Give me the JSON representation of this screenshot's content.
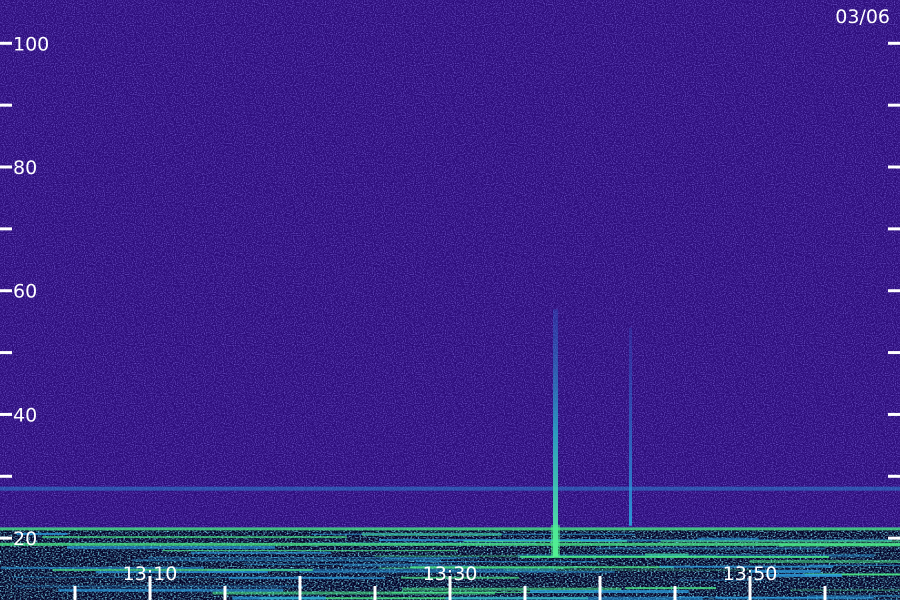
{
  "date_label": "03/06",
  "colors": {
    "background": "#2c0c7c",
    "noise_low": "#1e0a66",
    "noise_high": "#3c28b8",
    "band_cyan": "#2a9ee0",
    "band_green": "#4cf08a",
    "axis_text": "#ffffff",
    "tick": "#ffffff"
  },
  "chart_data": {
    "type": "heatmap",
    "title": "",
    "xlabel": "",
    "ylabel": "",
    "y_tick_labels": [
      "20",
      "40",
      "60",
      "80",
      "100"
    ],
    "y_ticks": [
      20,
      30,
      40,
      50,
      60,
      70,
      80,
      90,
      100
    ],
    "ylim": [
      10,
      107
    ],
    "x_tick_labels": [
      "13:10",
      "13:30",
      "13:50"
    ],
    "x_major_ticks": [
      "13:05",
      "13:10",
      "13:15",
      "13:20",
      "13:25",
      "13:30",
      "13:35",
      "13:40",
      "13:45",
      "13:50",
      "13:55"
    ],
    "xlim": [
      "13:00",
      "13:60"
    ],
    "noise_floor_edge": 21.5,
    "features": [
      {
        "type": "vertical-streak",
        "time": "13:37",
        "from": 17,
        "to": 57,
        "intensity": "high"
      },
      {
        "type": "vertical-streak",
        "time": "13:42",
        "from": 22,
        "to": 54,
        "intensity": "medium"
      },
      {
        "type": "horizontal-band",
        "level": 28,
        "intensity": "medium"
      },
      {
        "type": "horizontal-band",
        "level": 21.5,
        "intensity": "high"
      },
      {
        "type": "horizontal-band",
        "level": 19,
        "intensity": "high"
      }
    ],
    "grid": false,
    "legend": "none"
  }
}
